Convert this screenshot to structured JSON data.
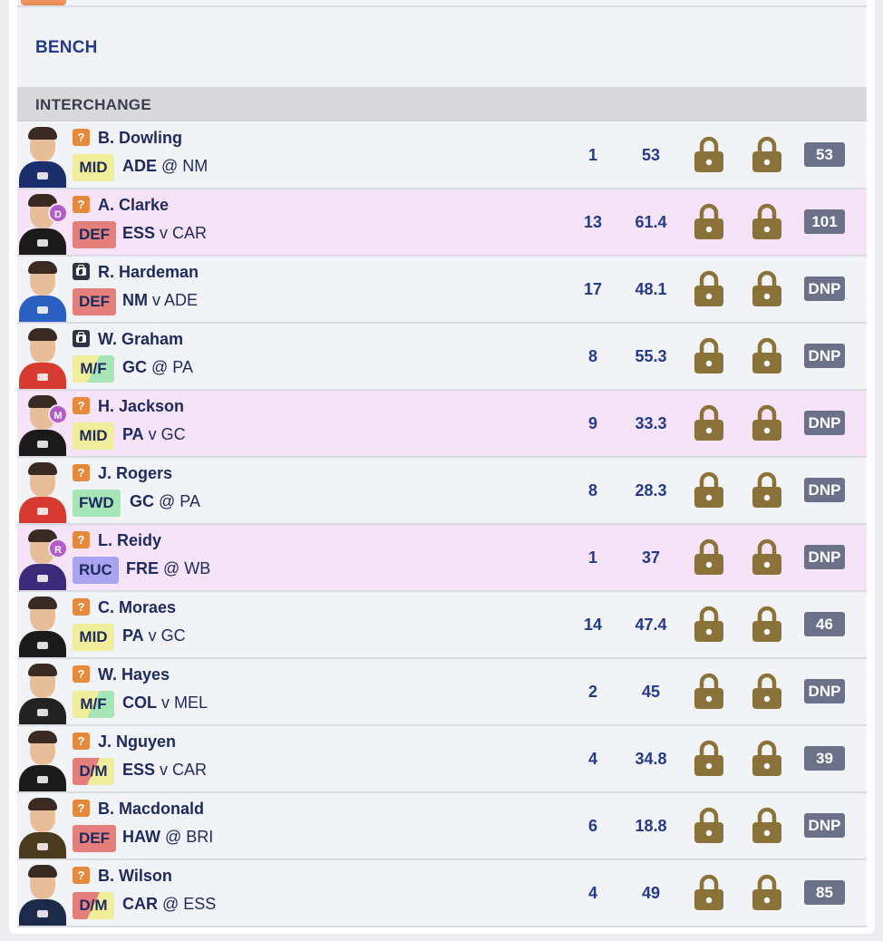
{
  "bench_title": "BENCH",
  "section_title": "INTERCHANGE",
  "colors": {
    "lock": "#8a7238",
    "score_bg": "#6b7189",
    "highlight_row": "#f7e3f8",
    "flag": "#b05ec6"
  },
  "players": [
    {
      "status": "?",
      "status_type": "questionable",
      "name": "B. Dowling",
      "pos": "MID",
      "pos_class": "MID",
      "team": "ADE",
      "fixture": " @ NM",
      "c1": "1",
      "c2": "53",
      "score": "53",
      "highlight": false,
      "flag": "",
      "jersey": "#1c2d6b"
    },
    {
      "status": "?",
      "status_type": "questionable",
      "name": "A. Clarke",
      "pos": "DEF",
      "pos_class": "DEF",
      "team": "ESS",
      "fixture": " v CAR",
      "c1": "13",
      "c2": "61.4",
      "score": "101",
      "highlight": true,
      "flag": "D",
      "jersey": "#1a1a1a"
    },
    {
      "status": "",
      "status_type": "injured",
      "name": "R. Hardeman",
      "pos": "DEF",
      "pos_class": "DEF",
      "team": "NM",
      "fixture": " v ADE",
      "c1": "17",
      "c2": "48.1",
      "score": "DNP",
      "highlight": false,
      "flag": "",
      "jersey": "#2c5fc4"
    },
    {
      "status": "",
      "status_type": "injured",
      "name": "W. Graham",
      "pos": "M/F",
      "pos_class": "MF",
      "team": "GC",
      "fixture": " @ PA",
      "c1": "8",
      "c2": "55.3",
      "score": "DNP",
      "highlight": false,
      "flag": "",
      "jersey": "#d63a30"
    },
    {
      "status": "?",
      "status_type": "questionable",
      "name": "H. Jackson",
      "pos": "MID",
      "pos_class": "MID",
      "team": "PA",
      "fixture": " v GC",
      "c1": "9",
      "c2": "33.3",
      "score": "DNP",
      "highlight": true,
      "flag": "M",
      "jersey": "#1a1a1a"
    },
    {
      "status": "?",
      "status_type": "questionable",
      "name": "J. Rogers",
      "pos": "FWD",
      "pos_class": "FWD",
      "team": "GC",
      "fixture": " @ PA",
      "c1": "8",
      "c2": "28.3",
      "score": "DNP",
      "highlight": false,
      "flag": "",
      "jersey": "#d63a30"
    },
    {
      "status": "?",
      "status_type": "questionable",
      "name": "L. Reidy",
      "pos": "RUC",
      "pos_class": "RUC",
      "team": "FRE",
      "fixture": " @ WB",
      "c1": "1",
      "c2": "37",
      "score": "DNP",
      "highlight": true,
      "flag": "R",
      "jersey": "#3b2a7a"
    },
    {
      "status": "?",
      "status_type": "questionable",
      "name": "C. Moraes",
      "pos": "MID",
      "pos_class": "MID",
      "team": "PA",
      "fixture": " v GC",
      "c1": "14",
      "c2": "47.4",
      "score": "46",
      "highlight": false,
      "flag": "",
      "jersey": "#1a1a1a"
    },
    {
      "status": "?",
      "status_type": "questionable",
      "name": "W. Hayes",
      "pos": "M/F",
      "pos_class": "MF",
      "team": "COL",
      "fixture": " v MEL",
      "c1": "2",
      "c2": "45",
      "score": "DNP",
      "highlight": false,
      "flag": "",
      "jersey": "#222222"
    },
    {
      "status": "?",
      "status_type": "questionable",
      "name": "J. Nguyen",
      "pos": "D/M",
      "pos_class": "DM",
      "team": "ESS",
      "fixture": " v CAR",
      "c1": "4",
      "c2": "34.8",
      "score": "39",
      "highlight": false,
      "flag": "",
      "jersey": "#1a1a1a"
    },
    {
      "status": "?",
      "status_type": "questionable",
      "name": "B. Macdonald",
      "pos": "DEF",
      "pos_class": "DEF",
      "team": "HAW",
      "fixture": " @ BRI",
      "c1": "6",
      "c2": "18.8",
      "score": "DNP",
      "highlight": false,
      "flag": "",
      "jersey": "#4a3a1e"
    },
    {
      "status": "?",
      "status_type": "questionable",
      "name": "B. Wilson",
      "pos": "D/M",
      "pos_class": "DM",
      "team": "CAR",
      "fixture": " @ ESS",
      "c1": "4",
      "c2": "49",
      "score": "85",
      "highlight": false,
      "flag": "",
      "jersey": "#1c2a4a"
    }
  ]
}
